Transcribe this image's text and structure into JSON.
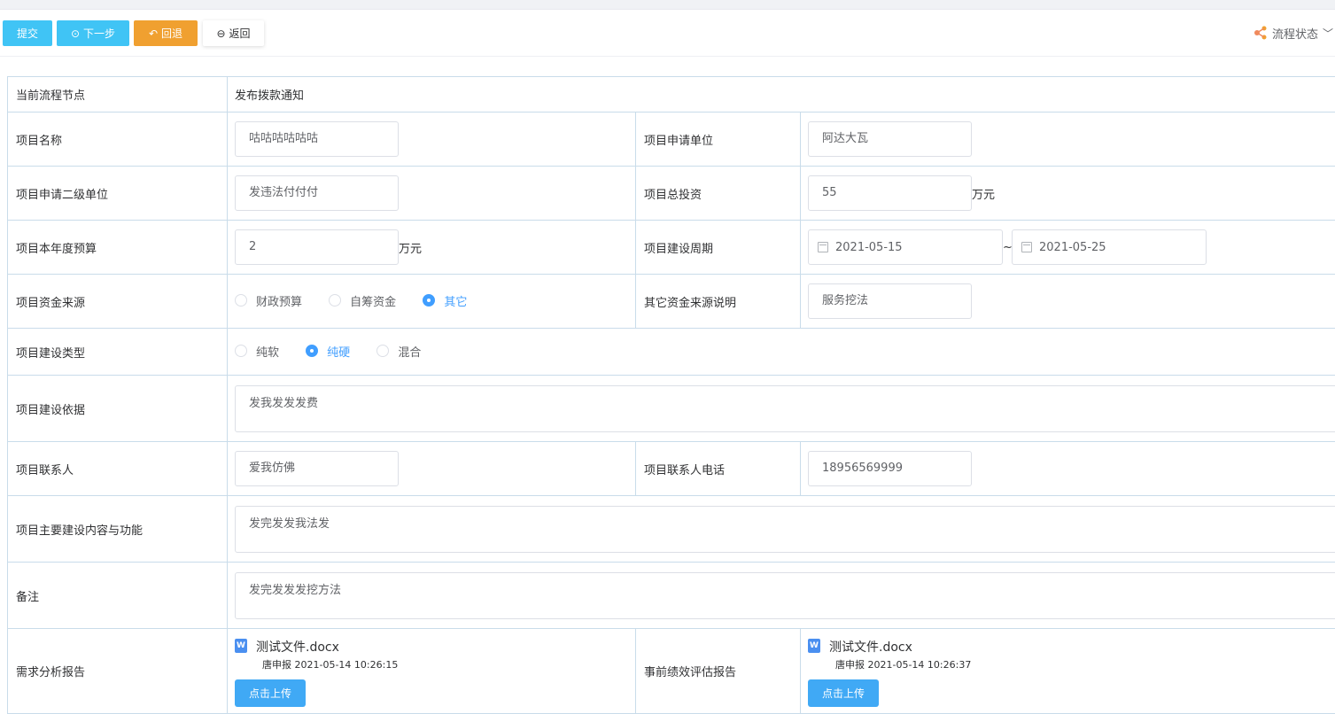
{
  "toolbar": {
    "submit": "提交",
    "next": "下一步",
    "back": "回退",
    "return": "返回",
    "flow_status": "流程状态"
  },
  "form": {
    "node_label": "当前流程节点",
    "node_value": "发布拨款通知",
    "name_label": "项目名称",
    "name_value": "咕咕咕咕咕咕",
    "unit_label": "项目申请单位",
    "unit_value": "阿达大瓦",
    "subunit_label": "项目申请二级单位",
    "subunit_value": "发违法付付付",
    "total_label": "项目总投资",
    "total_value": "55",
    "total_unit": "万元",
    "budget_label": "项目本年度预算",
    "budget_value": "2",
    "budget_unit": "万元",
    "period_label": "项目建设周期",
    "period_start": "2021-05-15",
    "period_sep": "~",
    "period_end": "2021-05-25",
    "fund_label": "项目资金来源",
    "fund_options": [
      "财政预算",
      "自筹资金",
      "其它"
    ],
    "fund_selected": "其它",
    "other_fund_label": "其它资金来源说明",
    "other_fund_value": "服务挖法",
    "type_label": "项目建设类型",
    "type_options": [
      "纯软",
      "纯硬",
      "混合"
    ],
    "type_selected": "纯硬",
    "basis_label": "项目建设依据",
    "basis_value": "发我发发发费",
    "contact_label": "项目联系人",
    "contact_value": "爱我仿佛",
    "phone_label": "项目联系人电话",
    "phone_value": "18956569999",
    "content_label": "项目主要建设内容与功能",
    "content_value": "发完发发我法发",
    "remark_label": "备注",
    "remark_value": "发完发发发挖方法",
    "req_report_label": "需求分析报告",
    "req_file_name": "测试文件.docx",
    "req_file_meta": "唐申报  2021-05-14 10:26:15",
    "perf_report_label": "事前绩效评估报告",
    "perf_file_name": "测试文件.docx",
    "perf_file_meta": "唐申报  2021-05-14 10:26:37",
    "upload_label": "点击上传",
    "word_icon_letter": "W"
  }
}
